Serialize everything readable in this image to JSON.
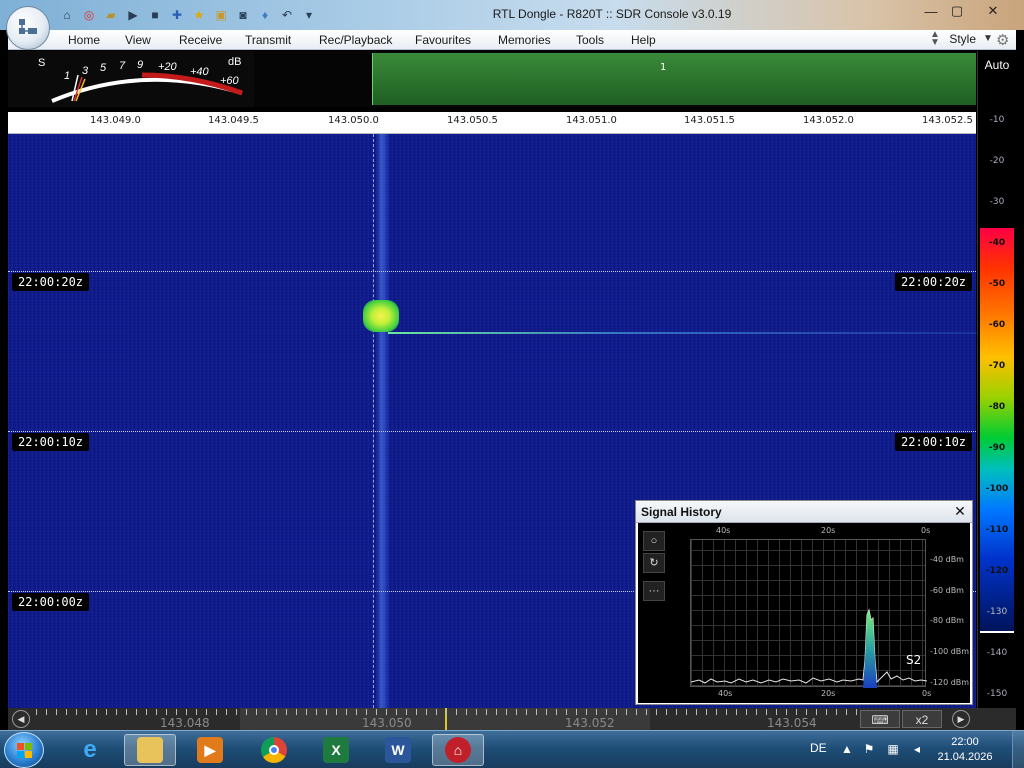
{
  "window": {
    "title": "RTL Dongle - R820T :: SDR Console v3.0.19",
    "minimize": "—",
    "maximize": "▢",
    "close": "✕"
  },
  "menu": {
    "items": [
      "Home",
      "View",
      "Receive",
      "Transmit",
      "Rec/Playback",
      "Favourites",
      "Memories",
      "Tools",
      "Help"
    ],
    "style_label": "Style"
  },
  "smeter": {
    "s_label": "S",
    "db_label": "dB",
    "scale": [
      "1",
      "3",
      "5",
      "7",
      "9",
      "+20",
      "+40",
      "+60"
    ]
  },
  "spectrum": {
    "channel_number": "1",
    "freq_ticks": [
      "143.049.0",
      "143.049.5",
      "143.050.0",
      "143.050.5",
      "143.051.0",
      "143.051.5",
      "143.052.0",
      "143.052.5"
    ]
  },
  "waterfall": {
    "timestamps": [
      "22:00:20z",
      "22:00:10z",
      "22:00:00z"
    ]
  },
  "db_scale": {
    "auto_label": "Auto",
    "labels": [
      "-10",
      "-20",
      "-30",
      "-40",
      "-50",
      "-60",
      "-70",
      "-80",
      "-90",
      "-100",
      "-110",
      "-120",
      "-130",
      "-140",
      "-150"
    ]
  },
  "bottom_ruler": {
    "labels": [
      "143.048",
      "143.050",
      "143.052",
      "143.054"
    ],
    "zoom_label": "x2"
  },
  "signal_history": {
    "title": "Signal History",
    "close": "✕",
    "time_top": [
      "40s",
      "20s",
      "0s"
    ],
    "time_bottom": [
      "40s",
      "20s",
      "0s"
    ],
    "dbm_labels": [
      "-40 dBm",
      "-60 dBm",
      "-80 dBm",
      "-100 dBm",
      "-120 dBm"
    ],
    "s_value": "S2",
    "tools": [
      "○",
      "↻",
      "···"
    ]
  },
  "taskbar": {
    "language": "DE",
    "time": "22:00",
    "date": "21.04.2026"
  },
  "colors": {
    "waterfall_bg": "#0b1680",
    "accent_green": "#3a8a3a",
    "taskbar": "#1f4e77"
  }
}
